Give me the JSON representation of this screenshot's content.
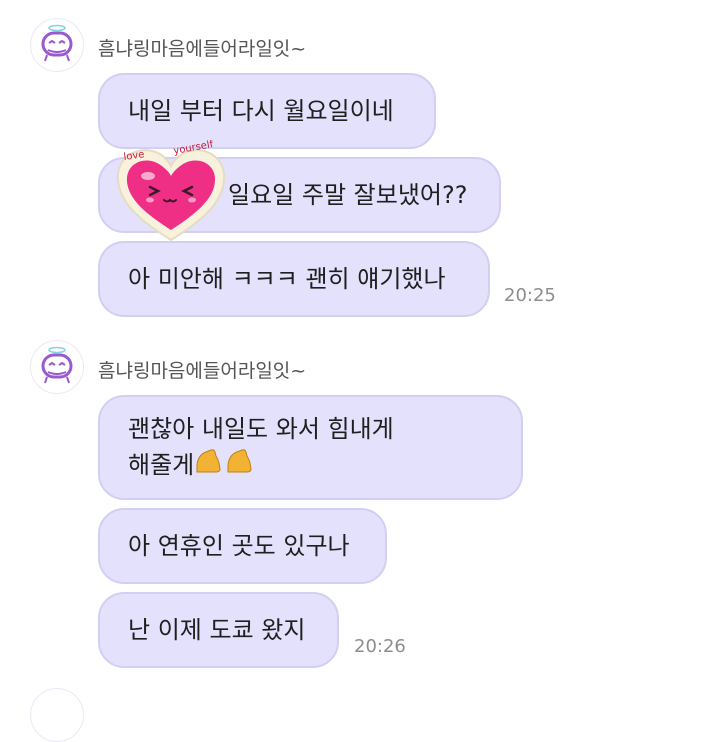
{
  "groups": [
    {
      "sender": "흠냐링마음에들어라일잇~",
      "messages": [
        {
          "text": "내일 부터 다시 월요일이네"
        },
        {
          "text": "일요일 주말 잘보냈어??",
          "sticker": {
            "text_left": "love",
            "text_right": "yourself"
          }
        },
        {
          "text": "아 미안해 ㅋㅋㅋ 괜히 얘기했나"
        }
      ],
      "time": "20:25"
    },
    {
      "sender": "흠냐링마음에들어라일잇~",
      "messages": [
        {
          "line1": "괜찮아 내일도 와서 힘내게",
          "line2": "해줄게"
        },
        {
          "text": "아 연휴인 곳도 있구나"
        },
        {
          "text": "난 이제 도쿄 왔지"
        }
      ],
      "time": "20:26"
    }
  ],
  "colors": {
    "bubble": "#e3e1fb",
    "bubble_border": "#d2cff3",
    "avatar_accent": "#9b59d0",
    "sticker_heart": "#ef2f86"
  },
  "icons": {
    "avatar": "ghost-face-icon",
    "emoji": "flexed-biceps-icon"
  }
}
